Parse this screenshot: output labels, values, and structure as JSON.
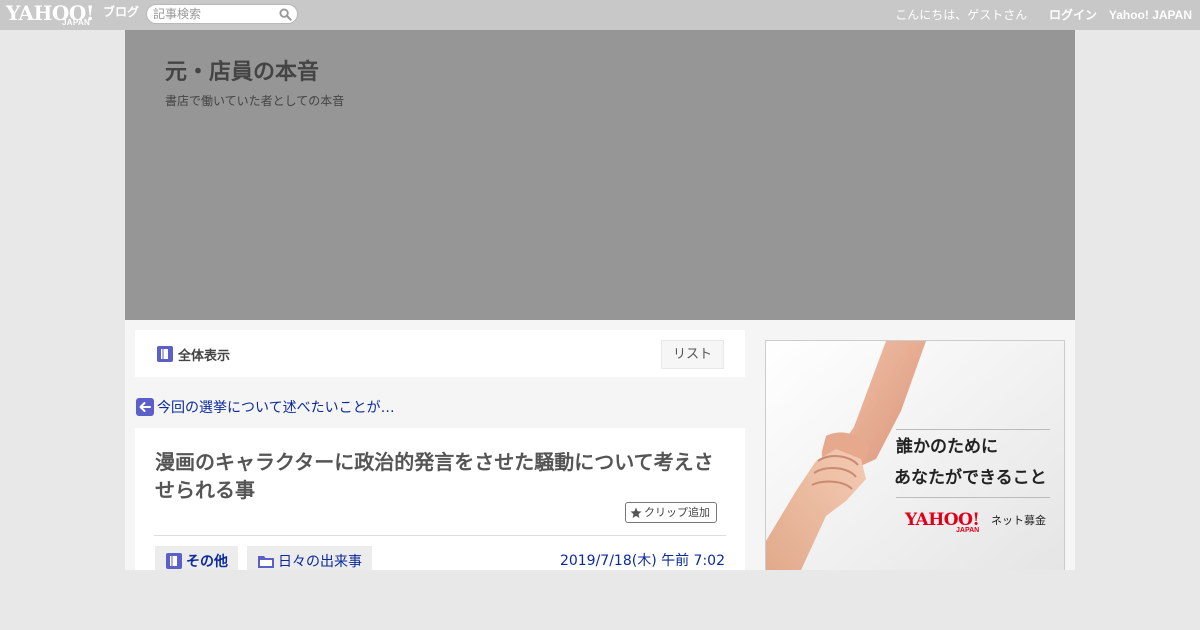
{
  "topbar": {
    "logo_text": "YAHOO!",
    "logo_sub": "JAPAN",
    "service_label": "ブログ",
    "search_placeholder": "記事検索",
    "greeting": "こんにちは、ゲストさん",
    "login_label": "ログイン",
    "yahoo_japan_label": "Yahoo! JAPAN"
  },
  "blog": {
    "title": "元・店員の本音",
    "description": "書店で働いていた者としての本音"
  },
  "nav": {
    "all_view_label": "全体表示",
    "list_label": "リスト"
  },
  "prev_article": {
    "label": "今回の選挙について述べたいことが…"
  },
  "article": {
    "title": "漫画のキャラクターに政治的発言をさせた騒動について考えさせられる事",
    "clip_label": "クリップ追加",
    "category_label": "その他",
    "folder_label": "日々の出来事",
    "date": "2019/7/18(木) 午前 7:02"
  },
  "ad": {
    "line1": "誰かのために",
    "line2": "あなたができること",
    "logo_text": "YAHOO!",
    "logo_sub": "JAPAN",
    "service_text": "ネット募金"
  },
  "colors": {
    "topbar_bg": "#c8c8c8",
    "header_bg": "#969696",
    "link": "#0b2a9e",
    "icon_accent": "#5b5fc7"
  }
}
